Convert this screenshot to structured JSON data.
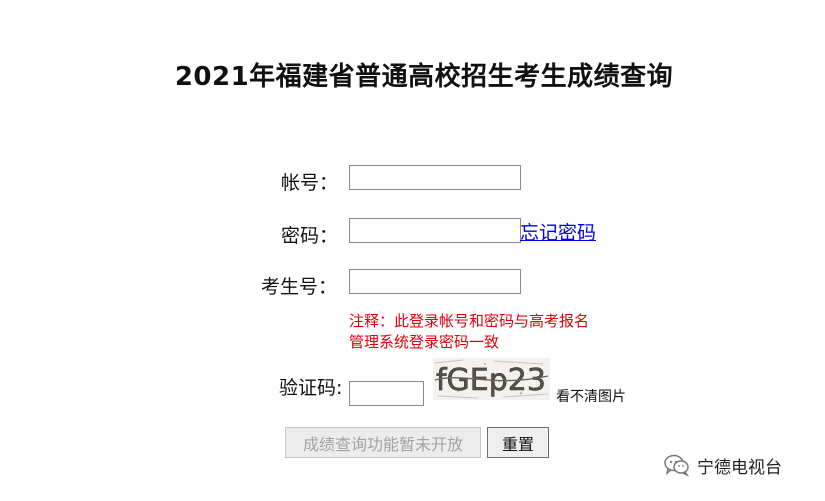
{
  "page": {
    "title": "2021年福建省普通高校招生考生成绩查询"
  },
  "form": {
    "account_label": "帐号：",
    "account_value": "",
    "password_label": "密码：",
    "password_value": "",
    "forgot_password": "忘记密码",
    "exam_no_label": "考生号：",
    "exam_no_value": "",
    "note_line1": "注释：此登录帐号和密码与高考报名",
    "note_line2": "管理系统登录密码一致",
    "captcha_label": "验证码:",
    "captcha_value": "",
    "captcha_text": "fGEp23",
    "captcha_refresh": "看不清图片",
    "query_button": "成绩查询功能暂未开放",
    "reset_button": "重置"
  },
  "watermark": {
    "text": "宁德电视台",
    "icon": "wechat-icon"
  },
  "colors": {
    "note": "#e0000a",
    "link": "#0000ee",
    "disabled_text": "#a3a3a3"
  }
}
